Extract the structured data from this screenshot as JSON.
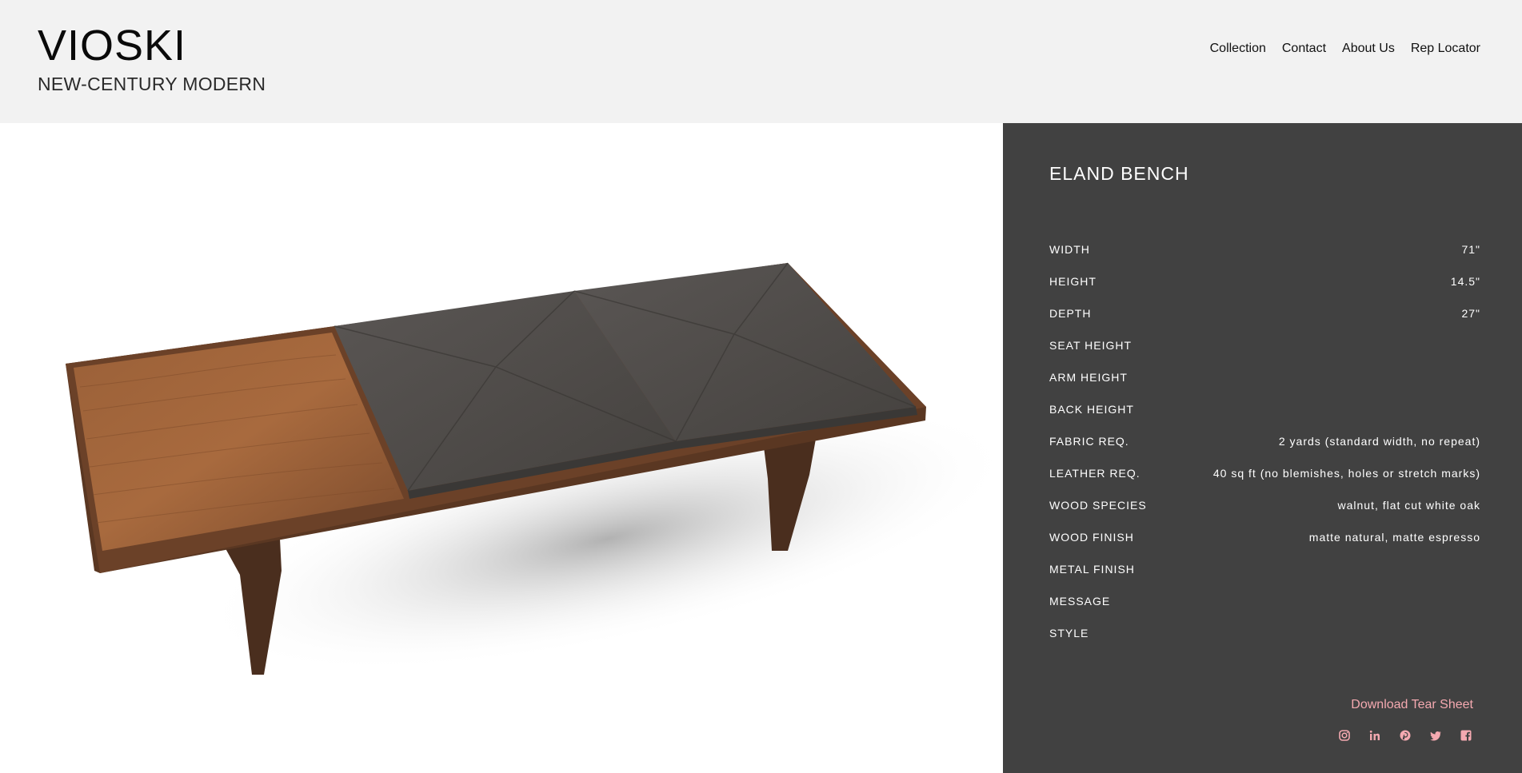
{
  "header": {
    "logo": "VIOSKI",
    "tagline": "NEW-CENTURY MODERN",
    "nav": [
      "Collection",
      "Contact",
      "About Us",
      "Rep Locator"
    ]
  },
  "product": {
    "title": "ELAND BENCH",
    "image_icon": "bench-product-photo",
    "specs": [
      {
        "label": "WIDTH",
        "value": "71\""
      },
      {
        "label": "HEIGHT",
        "value": "14.5\""
      },
      {
        "label": "DEPTH",
        "value": "27\""
      },
      {
        "label": "SEAT HEIGHT",
        "value": ""
      },
      {
        "label": "ARM HEIGHT",
        "value": ""
      },
      {
        "label": "BACK HEIGHT",
        "value": ""
      },
      {
        "label": "FABRIC REQ.",
        "value": "2 yards (standard width, no repeat)"
      },
      {
        "label": "LEATHER REQ.",
        "value": "40 sq ft (no blemishes, holes or stretch marks)"
      },
      {
        "label": "WOOD SPECIES",
        "value": "walnut, flat cut white oak"
      },
      {
        "label": "WOOD FINISH",
        "value": "matte natural, matte espresso"
      },
      {
        "label": "METAL FINISH",
        "value": ""
      },
      {
        "label": "MESSAGE",
        "value": ""
      },
      {
        "label": "STYLE",
        "value": ""
      }
    ],
    "download_label": "Download Tear Sheet"
  },
  "social": [
    "instagram-icon",
    "linkedin-icon",
    "pinterest-icon",
    "twitter-icon",
    "facebook-icon"
  ],
  "colors": {
    "header_bg": "#f2f2f2",
    "panel_bg": "#414141",
    "accent_pink": "#f4a9b0"
  }
}
